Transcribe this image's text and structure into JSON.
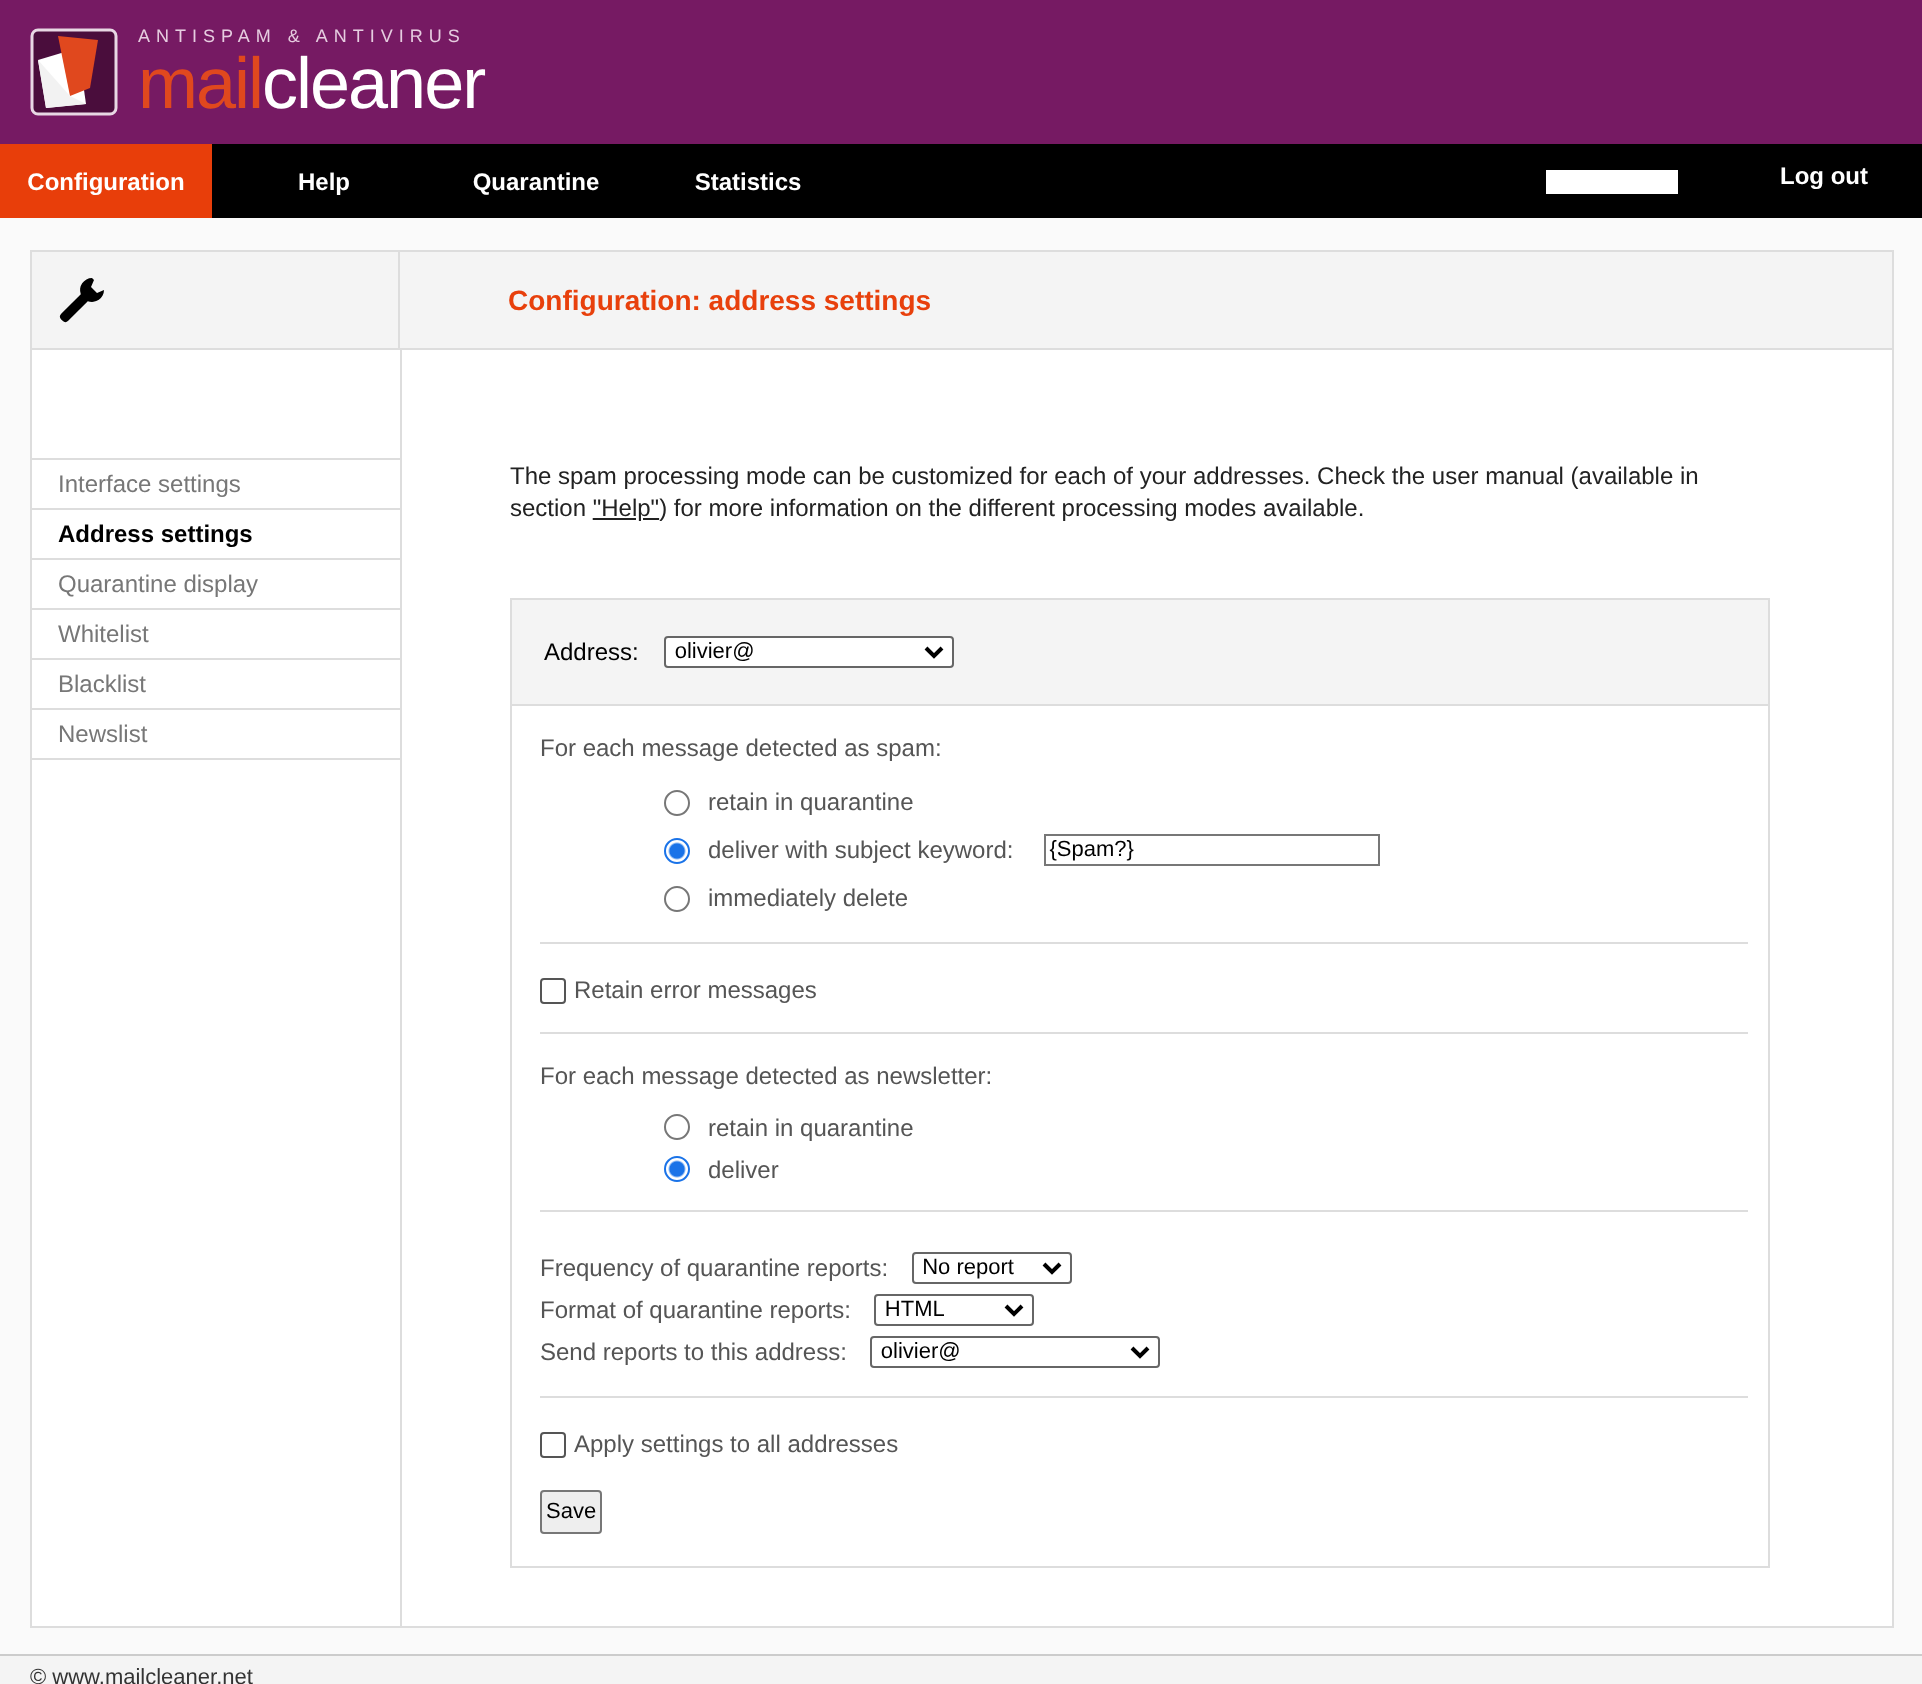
{
  "header": {
    "tagline": "ANTISPAM & ANTIVIRUS",
    "brand_first": "mail",
    "brand_second": "cleaner"
  },
  "nav": {
    "tabs": [
      {
        "label": "Configuration",
        "selected": true
      },
      {
        "label": "Help",
        "selected": false
      },
      {
        "label": "Quarantine",
        "selected": false
      },
      {
        "label": "Statistics",
        "selected": false
      }
    ],
    "logout": "Log out"
  },
  "page_title": "Configuration: address settings",
  "sidebar": {
    "items": [
      {
        "label": "Interface settings",
        "selected": false
      },
      {
        "label": "Address settings",
        "selected": true
      },
      {
        "label": "Quarantine display",
        "selected": false
      },
      {
        "label": "Whitelist",
        "selected": false
      },
      {
        "label": "Blacklist",
        "selected": false
      },
      {
        "label": "Newslist",
        "selected": false
      }
    ]
  },
  "intro": {
    "before": "The spam processing mode can be customized for each of your addresses. Check the user manual (available in section ",
    "link": "\"Help\"",
    "after": ") for more information on the different processing modes available."
  },
  "address": {
    "label": "Address:",
    "value": "olivier@"
  },
  "spam": {
    "heading": "For each message detected as spam:",
    "options": [
      {
        "label": "retain in quarantine",
        "selected": false
      },
      {
        "label": "deliver with subject keyword:",
        "selected": true,
        "keyword": "{Spam?}"
      },
      {
        "label": "immediately delete",
        "selected": false
      }
    ]
  },
  "retain_errors": {
    "label": "Retain error messages",
    "checked": false
  },
  "newsletter": {
    "heading": "For each message detected as newsletter:",
    "options": [
      {
        "label": "retain in quarantine",
        "selected": false
      },
      {
        "label": "deliver",
        "selected": true
      }
    ]
  },
  "reports": [
    {
      "label": "Frequency of quarantine reports:",
      "value": "No report"
    },
    {
      "label": "Format of quarantine reports:",
      "value": "HTML"
    },
    {
      "label": "Send reports to this address:",
      "value": "olivier@"
    }
  ],
  "apply_all": {
    "label": "Apply settings to all addresses",
    "checked": false
  },
  "save": "Save",
  "footer": "© www.mailcleaner.net"
}
